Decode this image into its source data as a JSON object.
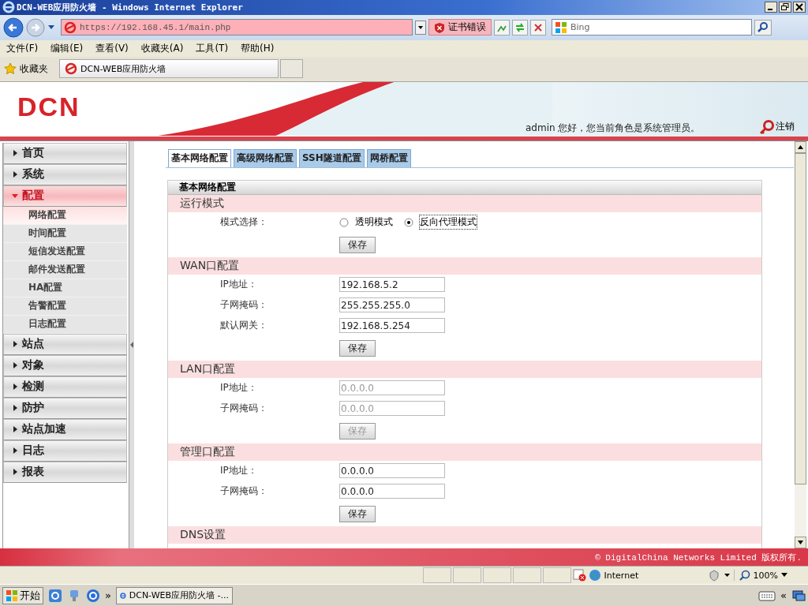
{
  "window": {
    "title": "DCN-WEB应用防火墙 - Windows Internet Explorer"
  },
  "browser": {
    "address": "https://192.168.45.1/main.php",
    "cert_error": "证书错误",
    "search_placeholder": "Bing",
    "menu": [
      "文件(F)",
      "编辑(E)",
      "查看(V)",
      "收藏夹(A)",
      "工具(T)",
      "帮助(H)"
    ],
    "favorites": "收藏夹",
    "tab": "DCN-WEB应用防火墙"
  },
  "header": {
    "logo": "DCN",
    "greeting": "admin 您好，您当前角色是系统管理员。",
    "logout": "注销"
  },
  "sidebar": {
    "items": [
      {
        "label": "首页",
        "expanded": false
      },
      {
        "label": "系统",
        "expanded": false
      },
      {
        "label": "配置",
        "expanded": true,
        "children": [
          {
            "label": "网络配置",
            "selected": true
          },
          {
            "label": "时间配置",
            "selected": false
          },
          {
            "label": "短信发送配置",
            "selected": false
          },
          {
            "label": "邮件发送配置",
            "selected": false
          },
          {
            "label": "HA配置",
            "selected": false
          },
          {
            "label": "告警配置",
            "selected": false
          },
          {
            "label": "日志配置",
            "selected": false
          }
        ]
      },
      {
        "label": "站点",
        "expanded": false
      },
      {
        "label": "对象",
        "expanded": false
      },
      {
        "label": "检测",
        "expanded": false
      },
      {
        "label": "防护",
        "expanded": false
      },
      {
        "label": "站点加速",
        "expanded": false
      },
      {
        "label": "日志",
        "expanded": false
      },
      {
        "label": "报表",
        "expanded": false
      }
    ]
  },
  "tabs": [
    {
      "label": "基本网络配置",
      "selected": true
    },
    {
      "label": "高级网络配置",
      "selected": false
    },
    {
      "label": "SSH隧道配置",
      "selected": false
    },
    {
      "label": "网桥配置",
      "selected": false
    }
  ],
  "panel": {
    "title": "基本网络配置",
    "sections": [
      {
        "title": "运行模式",
        "rows": [
          {
            "kind": "radio",
            "label": "模式选择：",
            "options": [
              {
                "label": "透明模式",
                "selected": false
              },
              {
                "label": "反向代理模式",
                "selected": true
              }
            ]
          }
        ],
        "button": {
          "label": "保存",
          "disabled": false
        }
      },
      {
        "title": "WAN口配置",
        "rows": [
          {
            "kind": "text",
            "label": "IP地址：",
            "value": "192.168.5.2",
            "disabled": false
          },
          {
            "kind": "text",
            "label": "子网掩码：",
            "value": "255.255.255.0",
            "disabled": false
          },
          {
            "kind": "text",
            "label": "默认网关：",
            "value": "192.168.5.254",
            "disabled": false
          }
        ],
        "button": {
          "label": "保存",
          "disabled": false
        }
      },
      {
        "title": "LAN口配置",
        "rows": [
          {
            "kind": "text",
            "label": "IP地址：",
            "value": "0.0.0.0",
            "disabled": true
          },
          {
            "kind": "text",
            "label": "子网掩码：",
            "value": "0.0.0.0",
            "disabled": true
          }
        ],
        "button": {
          "label": "保存",
          "disabled": true
        }
      },
      {
        "title": "管理口配置",
        "rows": [
          {
            "kind": "text",
            "label": "IP地址：",
            "value": "0.0.0.0",
            "disabled": false
          },
          {
            "kind": "text",
            "label": "子网掩码：",
            "value": "0.0.0.0",
            "disabled": false
          }
        ],
        "button": {
          "label": "保存",
          "disabled": false
        }
      },
      {
        "title": "DNS设置"
      }
    ]
  },
  "footer": "© DigitalChina Networks Limited 版权所有.",
  "status_bar": {
    "zone": "Internet",
    "zoom": "100%"
  },
  "taskbar": {
    "start": "开始",
    "more": "»",
    "task": "DCN-WEB应用防火墙 -...",
    "tray_more": "«"
  }
}
